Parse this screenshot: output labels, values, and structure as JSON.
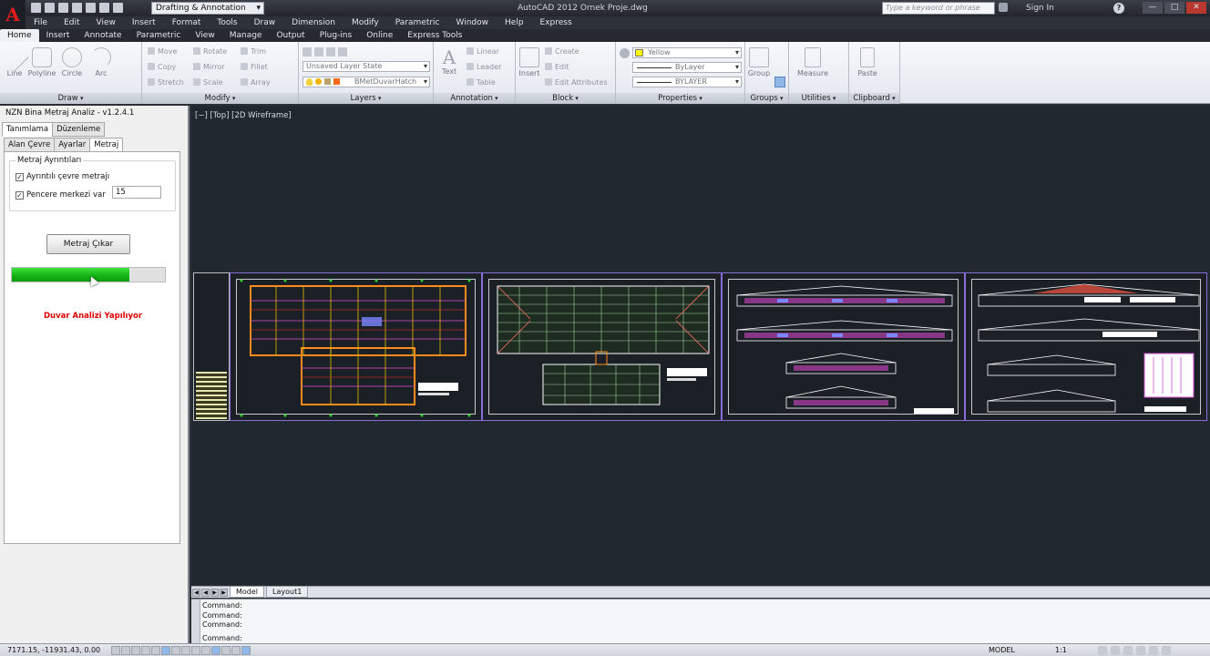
{
  "window": {
    "title": "AutoCAD 2012   Ornek Proje.dwg",
    "workspace": "Drafting & Annotation",
    "search_placeholder": "Type a keyword or phrase",
    "sign_in": "Sign In",
    "help": "?",
    "min": "—",
    "max": "□",
    "close": "✕"
  },
  "menu": [
    "File",
    "Edit",
    "View",
    "Insert",
    "Format",
    "Tools",
    "Draw",
    "Dimension",
    "Modify",
    "Parametric",
    "Window",
    "Help",
    "Express"
  ],
  "ribbon_tabs": [
    "Home",
    "Insert",
    "Annotate",
    "Parametric",
    "View",
    "Manage",
    "Output",
    "Plug-ins",
    "Online",
    "Express Tools"
  ],
  "ribbon": {
    "draw": {
      "title": "Draw",
      "line": "Line",
      "polyline": "Polyline",
      "circle": "Circle",
      "arc": "Arc"
    },
    "modify": {
      "title": "Modify",
      "move": "Move",
      "rotate": "Rotate",
      "trim": "Trim",
      "copy": "Copy",
      "mirror": "Mirror",
      "fillet": "Fillet",
      "stretch": "Stretch",
      "scale": "Scale",
      "array": "Array"
    },
    "layers": {
      "title": "Layers",
      "state": "Unsaved Layer State",
      "current": "BMetDuvarHatch"
    },
    "annotation": {
      "title": "Annotation",
      "text": "Text",
      "linear": "Linear",
      "leader": "Leader",
      "table": "Table"
    },
    "block": {
      "title": "Block",
      "insert": "Insert",
      "create": "Create",
      "edit": "Edit",
      "edit_attributes": "Edit Attributes"
    },
    "properties": {
      "title": "Properties",
      "color": "Yellow",
      "linetype": "ByLayer",
      "lineweight": "BYLAYER"
    },
    "groups": {
      "title": "Groups",
      "group": "Group"
    },
    "utilities": {
      "title": "Utilities",
      "measure": "Measure"
    },
    "clipboard": {
      "title": "Clipboard",
      "paste": "Paste"
    }
  },
  "plugin": {
    "title": "NZN Bina Metraj Analiz - v1.2.4.1",
    "tabs_main": [
      "Tanımlama",
      "Düzenleme"
    ],
    "tabs_sub": [
      "Alan Çevre",
      "Ayarlar",
      "Metraj"
    ],
    "group_title": "Metraj Ayrıntıları",
    "check1": "Ayrıntılı çevre metrajı",
    "check2": "Pencere merkezi var",
    "window_center_value": "15",
    "button": "Metraj Çıkar",
    "progress_fraction": 0.77,
    "status": "Duvar Analizi Yapılıyor"
  },
  "viewport": {
    "label": "[−] [Top] [2D Wireframe]"
  },
  "layout_tabs": [
    "Model",
    "Layout1"
  ],
  "command": {
    "history": [
      "Command:",
      "Command:",
      "Command:"
    ],
    "prompt": "Command:"
  },
  "status": {
    "coords": "7171.15, -11931.43, 0.00",
    "model": "MODEL",
    "scale": "1:1"
  },
  "colors": {
    "accent": "#7b5fd6",
    "progress": "#16b416",
    "status_red": "#e10000"
  }
}
